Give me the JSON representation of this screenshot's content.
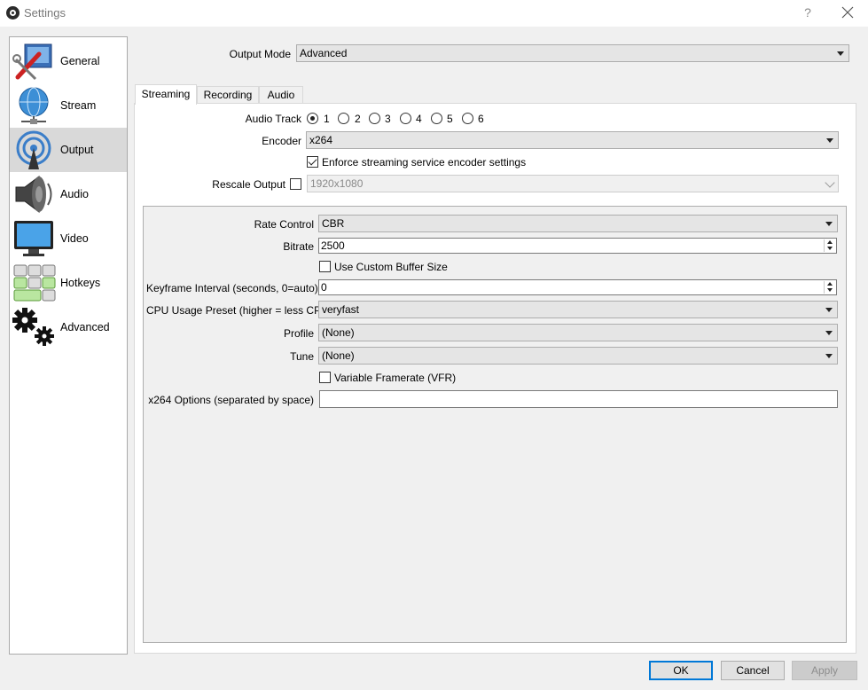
{
  "window": {
    "title": "Settings",
    "help_symbol": "?"
  },
  "sidebar": {
    "items": [
      {
        "label": "General",
        "icon": "wrench-screwdriver-icon",
        "active": false
      },
      {
        "label": "Stream",
        "icon": "globe-network-icon",
        "active": false
      },
      {
        "label": "Output",
        "icon": "broadcast-antenna-icon",
        "active": true
      },
      {
        "label": "Audio",
        "icon": "speaker-icon",
        "active": false
      },
      {
        "label": "Video",
        "icon": "monitor-icon",
        "active": false
      },
      {
        "label": "Hotkeys",
        "icon": "keyboard-icon",
        "active": false
      },
      {
        "label": "Advanced",
        "icon": "gears-icon",
        "active": false
      }
    ]
  },
  "output_mode": {
    "label": "Output Mode",
    "value": "Advanced"
  },
  "tabs": [
    {
      "label": "Streaming",
      "active": true
    },
    {
      "label": "Recording",
      "active": false
    },
    {
      "label": "Audio",
      "active": false
    }
  ],
  "streaming": {
    "audio_track": {
      "label": "Audio Track",
      "options": [
        "1",
        "2",
        "3",
        "4",
        "5",
        "6"
      ],
      "selected": "1"
    },
    "encoder": {
      "label": "Encoder",
      "value": "x264"
    },
    "enforce": {
      "label": "Enforce streaming service encoder settings",
      "checked": true
    },
    "rescale": {
      "label": "Rescale Output",
      "checked": false,
      "value": "1920x1080"
    },
    "rate_control": {
      "label": "Rate Control",
      "value": "CBR"
    },
    "bitrate": {
      "label": "Bitrate",
      "value": "2500"
    },
    "custom_buffer": {
      "label": "Use Custom Buffer Size",
      "checked": false
    },
    "keyframe": {
      "label": "Keyframe Interval (seconds, 0=auto)",
      "value": "0"
    },
    "cpu_preset": {
      "label": "CPU Usage Preset (higher = less CPU)",
      "value": "veryfast"
    },
    "profile": {
      "label": "Profile",
      "value": "(None)"
    },
    "tune": {
      "label": "Tune",
      "value": "(None)"
    },
    "vfr": {
      "label": "Variable Framerate (VFR)",
      "checked": false
    },
    "x264_options": {
      "label": "x264 Options (separated by space)",
      "value": ""
    }
  },
  "buttons": {
    "ok": "OK",
    "cancel": "Cancel",
    "apply": "Apply"
  },
  "colors": {
    "accent": "#0078d7",
    "selected_item": "#d9d9d9"
  }
}
